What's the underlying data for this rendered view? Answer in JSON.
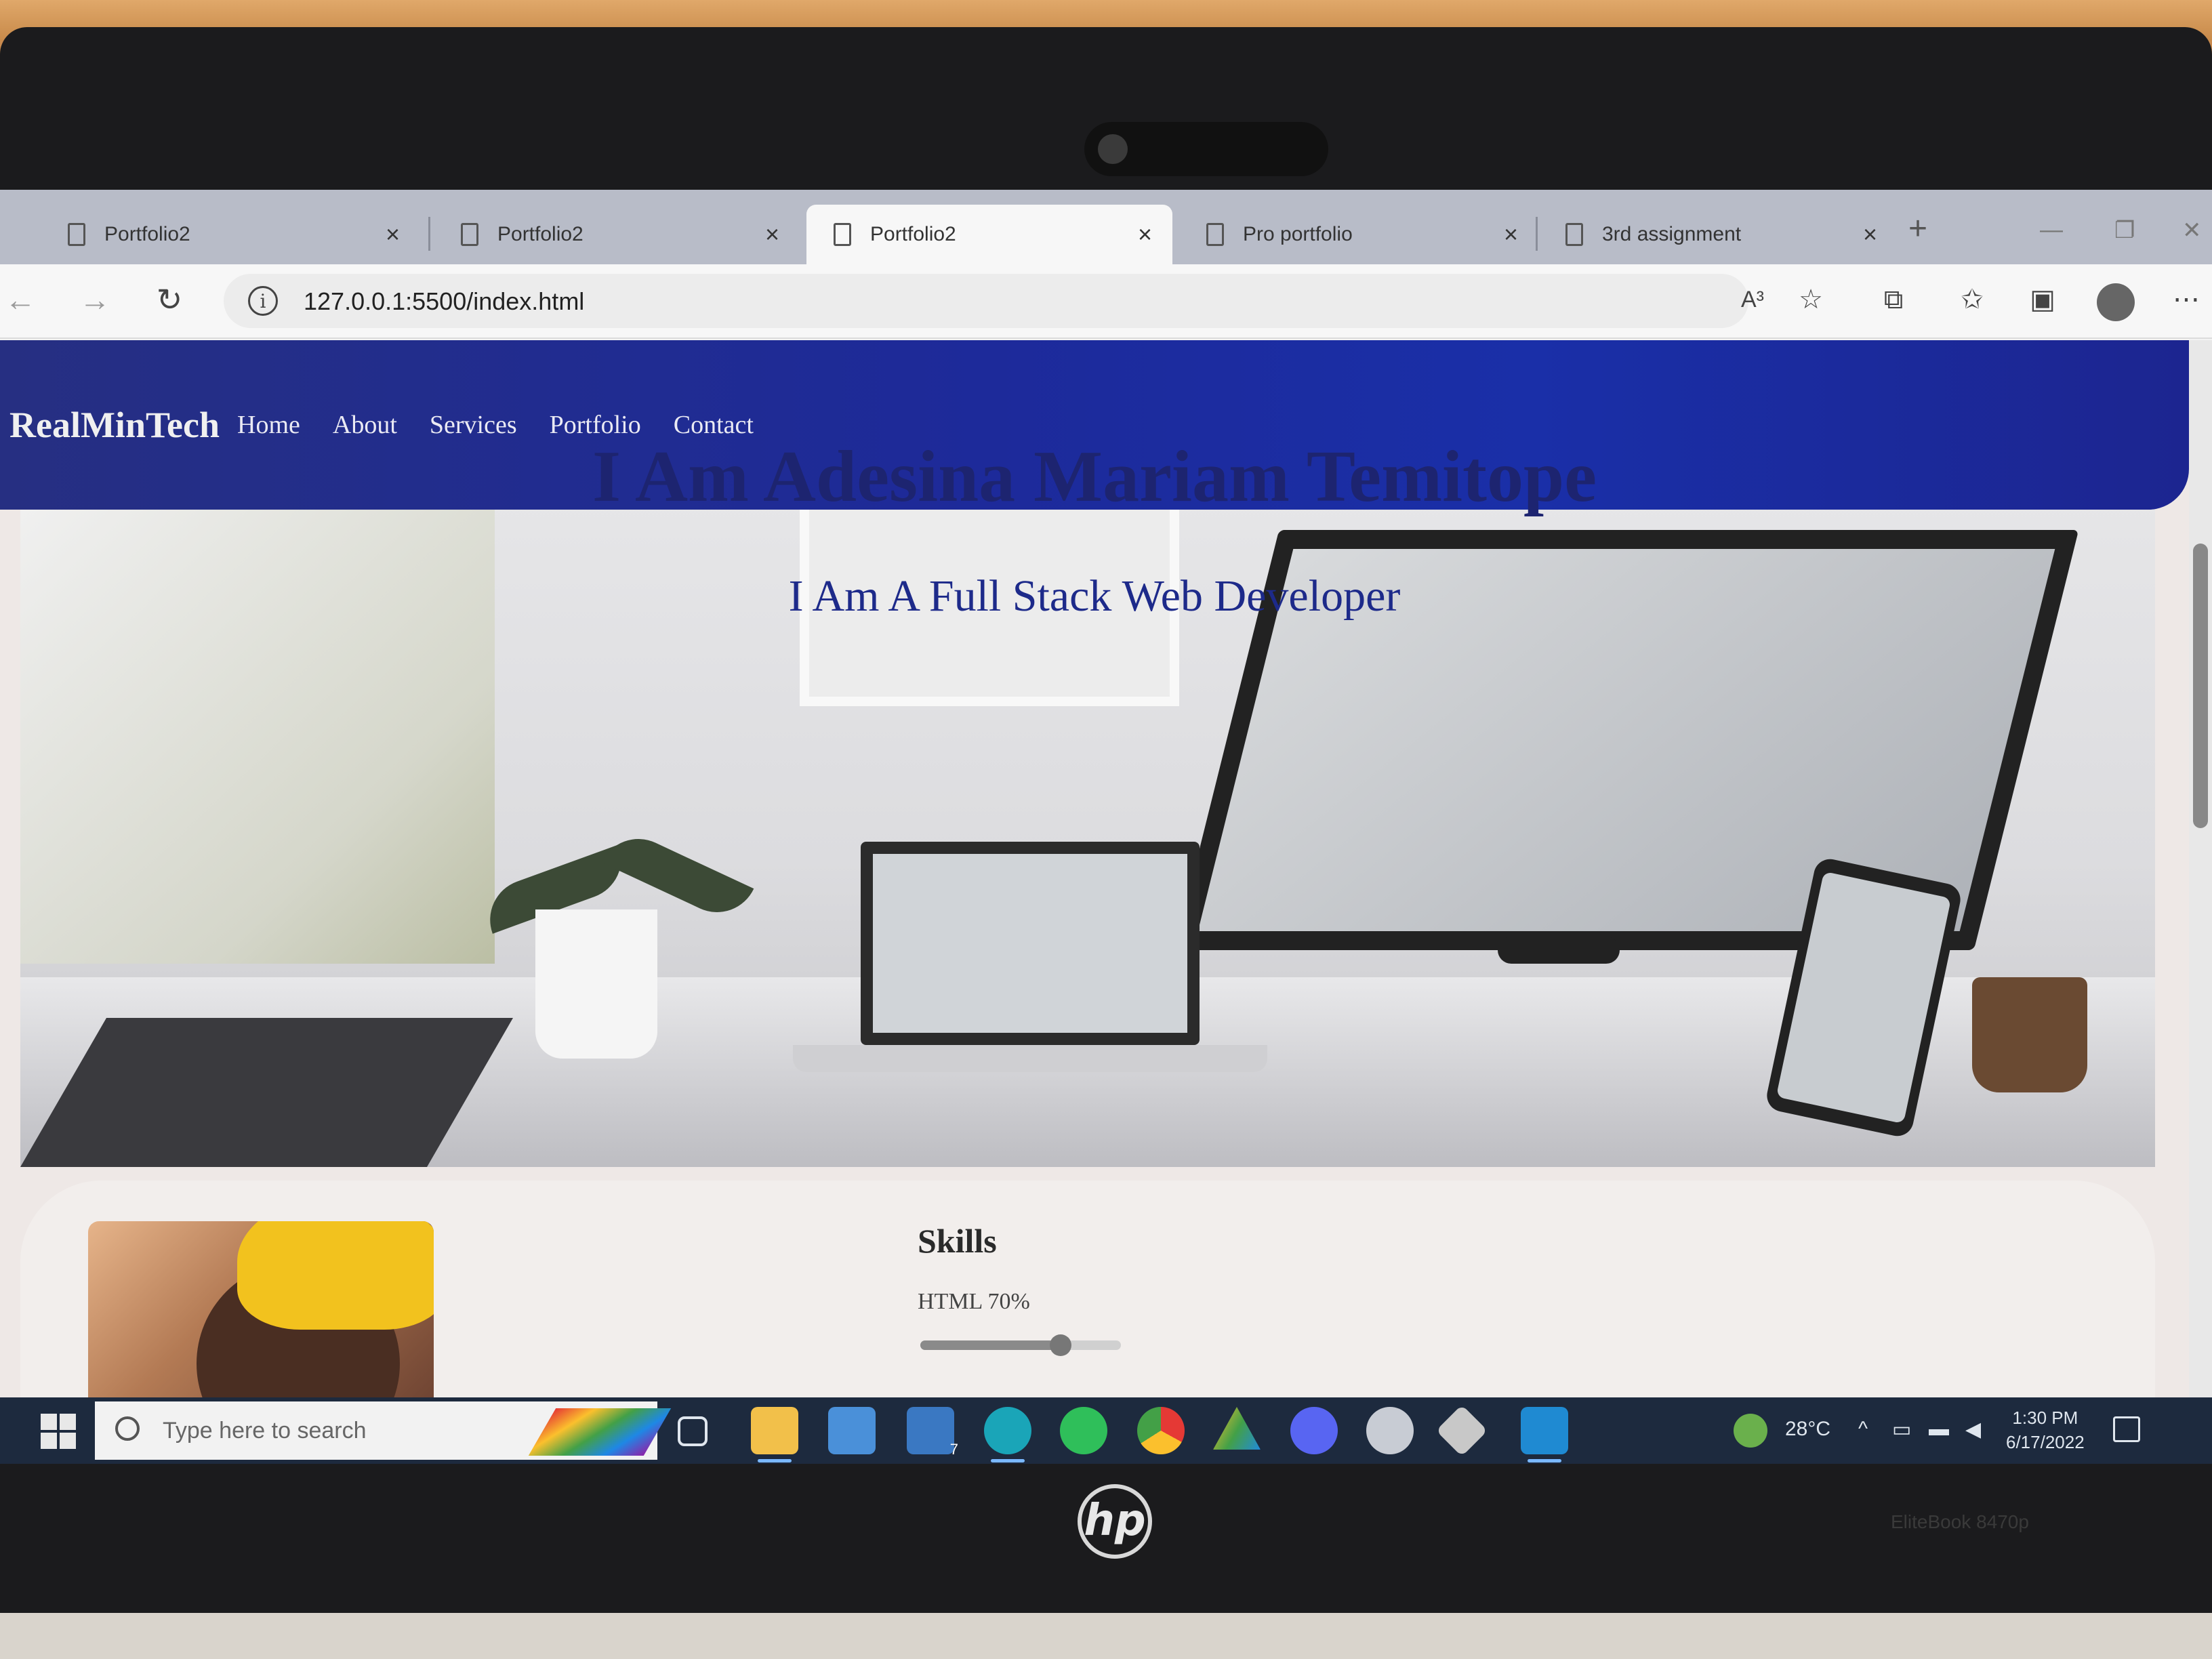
{
  "browser": {
    "tabs": [
      {
        "label": "Portfolio2",
        "active": false
      },
      {
        "label": "Portfolio2",
        "active": false
      },
      {
        "label": "Portfolio2",
        "active": true
      },
      {
        "label": "Pro portfolio",
        "active": false
      },
      {
        "label": "3rd assignment",
        "active": false
      }
    ],
    "close_glyph": "×",
    "new_tab_glyph": "+",
    "url": "127.0.0.1:5500/index.html",
    "read_aloud_glyph": "A³"
  },
  "page": {
    "brand": "RealMinTech",
    "nav_links": [
      "Home",
      "About",
      "Services",
      "Portfolio",
      "Contact"
    ],
    "hero": {
      "title": "I Am Adesina Mariam Temitope",
      "subtitle": "I Am A Full Stack Web Developer"
    },
    "skills": {
      "title": "Skills",
      "items": [
        {
          "label": "HTML 70%",
          "percent": 70
        }
      ]
    }
  },
  "taskbar": {
    "search_placeholder": "Type here to search",
    "apps": [
      "task-view",
      "file-explorer",
      "microsoft-store",
      "mail",
      "edge",
      "whatsapp",
      "chrome",
      "google-drive",
      "discord",
      "weather-app",
      "git",
      "vscode"
    ],
    "mail_badge": "7",
    "temperature": "28°C",
    "time": "1:30 PM",
    "date": "6/17/2022"
  },
  "device": {
    "logo": "hp",
    "model": "EliteBook 8470p"
  },
  "colors": {
    "navbar": "#1d2a9a",
    "hero_title": "#1d2470",
    "taskbar": "#1d2a3e"
  }
}
